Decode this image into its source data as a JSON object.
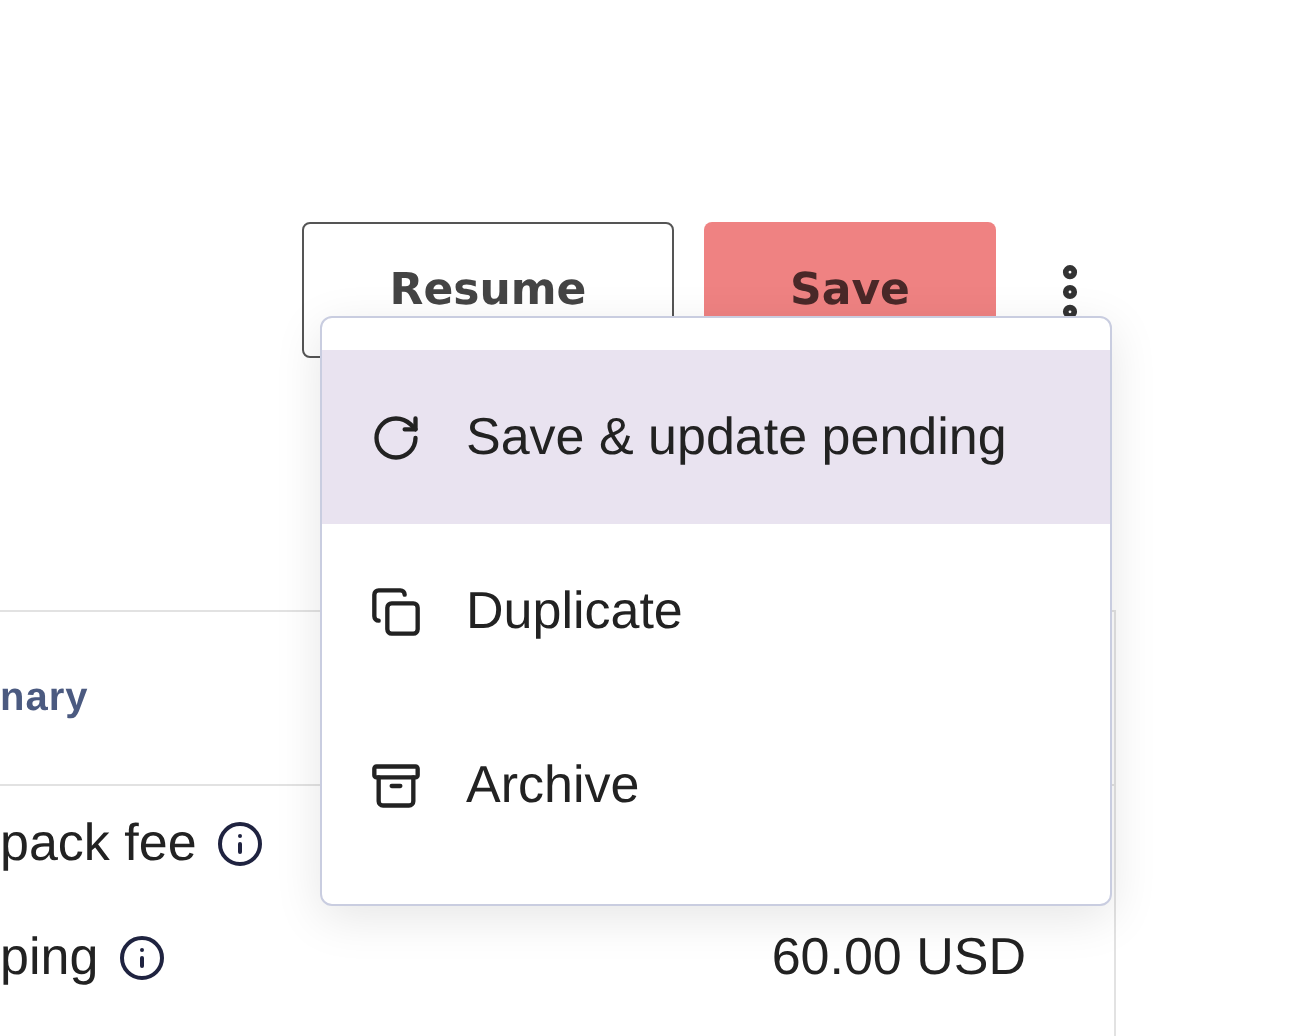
{
  "actions": [
    {
      "label": "Resume",
      "kind": "outline"
    },
    {
      "label": "Save",
      "kind": "primary"
    }
  ],
  "menu": {
    "items": [
      {
        "label": "Save & update pending",
        "selected": true
      },
      {
        "label": "Duplicate",
        "selected": false
      },
      {
        "label": "Archive",
        "selected": false
      }
    ]
  },
  "summary": {
    "heading": "nary",
    "rows": [
      {
        "label": "pack fee"
      },
      {
        "label": "ping",
        "amount": "60.00 USD"
      }
    ]
  }
}
